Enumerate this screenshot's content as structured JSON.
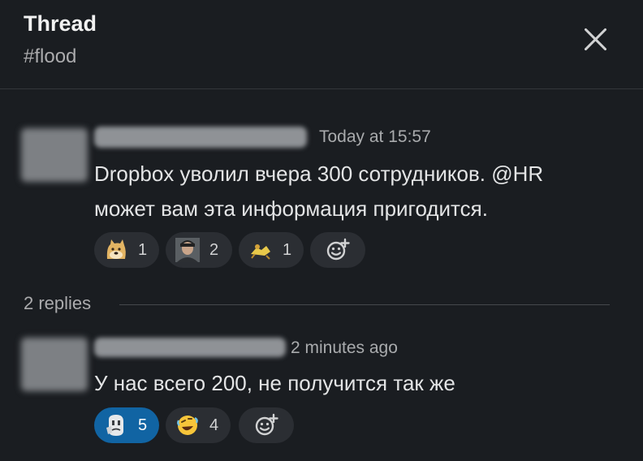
{
  "header": {
    "title": "Thread",
    "channel": "#flood"
  },
  "messages": [
    {
      "timestamp": "Today at 15:57",
      "lines": [
        "Dropbox уволил вчера 300 сотрудников. @HR",
        "может вам эта информация пригодится."
      ],
      "reactions": [
        {
          "emoji": "doge-emoji",
          "count": "1"
        },
        {
          "emoji": "person-photo-emoji",
          "count": "2"
        },
        {
          "emoji": "crawling-figure-emoji",
          "count": "1"
        }
      ]
    },
    {
      "timestamp": "2 minutes ago",
      "lines": [
        "У нас всего 200, не получится так же"
      ],
      "reactions": [
        {
          "emoji": "thinking-face-emoji",
          "count": "5",
          "active": true
        },
        {
          "emoji": "rofl-emoji",
          "count": "4"
        }
      ]
    }
  ],
  "replies": {
    "label": "2 replies"
  },
  "colors": {
    "background": "#1a1d21",
    "active_reaction": "#1164a3",
    "reaction_bg": "#2b2e33"
  }
}
